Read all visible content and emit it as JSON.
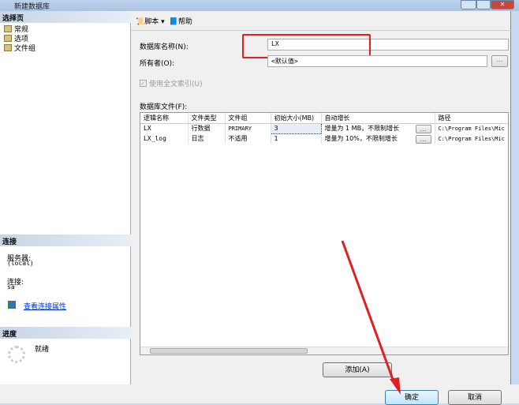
{
  "window": {
    "title": "新建数据库"
  },
  "left": {
    "select_page_header": "选择页",
    "pages": [
      "常规",
      "选项",
      "文件组"
    ],
    "connection_header": "连接",
    "server_label": "服务器:",
    "server_value": "(local)",
    "connection_label": "连接:",
    "connection_value": "sa",
    "view_props_link": "查看连接属性",
    "progress_header": "进度",
    "progress_status": "就绪"
  },
  "toolbar": {
    "script": "脚本",
    "help": "帮助"
  },
  "form": {
    "db_name_label": "数据库名称(N):",
    "db_name_value": "LX",
    "owner_label": "所有者(O):",
    "owner_value": "<默认值>",
    "fulltext_label": "使用全文索引(U)",
    "files_label": "数据库文件(F):"
  },
  "files_table": {
    "columns": [
      "逻辑名称",
      "文件类型",
      "文件组",
      "初始大小(MB)",
      "自动增长",
      "路径"
    ],
    "rows": [
      [
        "LX",
        "行数据",
        "PRIMARY",
        "3",
        "增量为 1 MB，不限制增长",
        "C:\\Program Files\\Mic"
      ],
      [
        "LX_log",
        "日志",
        "不适用",
        "1",
        "增量为 10%，不限制增长",
        "C:\\Program Files\\Mic"
      ]
    ],
    "ellipsis": "..."
  },
  "buttons": {
    "add": "添加(A)",
    "ok": "确定",
    "cancel": "取消"
  },
  "colors": {
    "highlight": "#e02020"
  }
}
